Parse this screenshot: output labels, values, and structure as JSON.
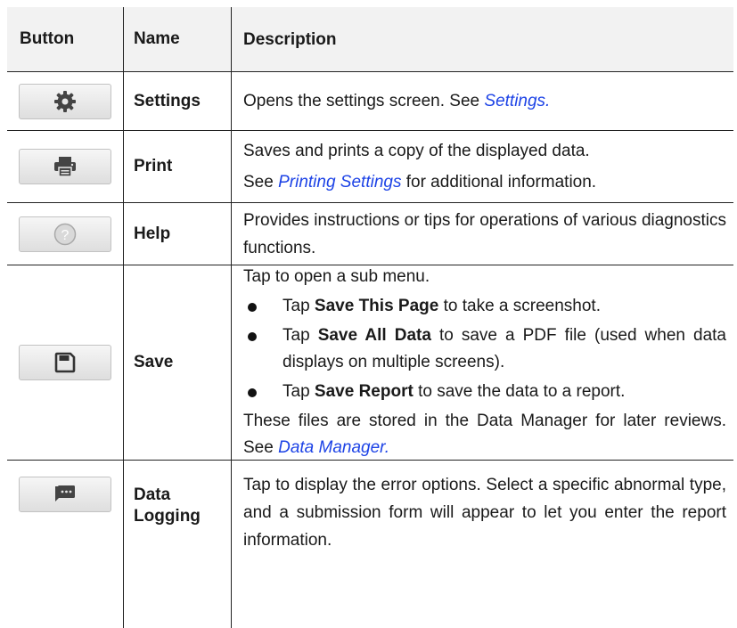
{
  "header": {
    "button": "Button",
    "name": "Name",
    "description": "Description"
  },
  "settings": {
    "name": "Settings",
    "desc": "Opens the settings screen. See ",
    "link": "Settings.",
    "icon": "gear-icon"
  },
  "print": {
    "name": "Print",
    "line1": "Saves and prints a copy of the displayed data.",
    "line2_pre": "See ",
    "link": "Printing Settings",
    "line2_post": " for additional information.",
    "icon": "printer-icon"
  },
  "help": {
    "name": "Help",
    "desc": "Provides instructions or tips for operations of various diagnostics functions.",
    "icon": "question-icon"
  },
  "save": {
    "name": "Save",
    "intro": "Tap to open a sub menu.",
    "bullets": [
      {
        "pre": "Tap ",
        "bold": "Save This Page",
        "post": " to take a screenshot."
      },
      {
        "pre": "Tap ",
        "bold": "Save All Data",
        "post": " to save a PDF file (used when data displays on multiple screens)."
      },
      {
        "pre": "Tap ",
        "bold": "Save Report",
        "post": " to save the data to a report."
      }
    ],
    "outro": "These files are stored in the Data Manager for later reviews. See ",
    "link": "Data Manager.",
    "icon": "floppy-disk-icon"
  },
  "datalog": {
    "name": "Data Logging",
    "desc": "Tap to display the error options. Select a specific abnormal type, and a submission form will appear to let you enter the report information.",
    "icon": "chat-message-icon"
  },
  "colors": {
    "link": "#1d43e6",
    "header_bg": "#f2f2f2",
    "icon": "#444444"
  }
}
